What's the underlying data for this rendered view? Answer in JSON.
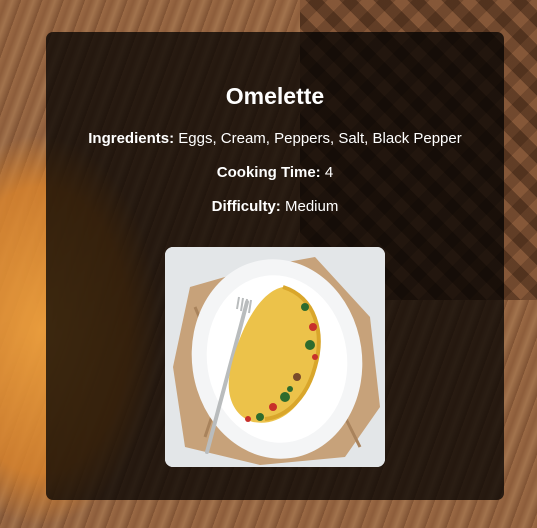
{
  "recipe": {
    "title": "Omelette",
    "ingredients_label": "Ingredients:",
    "ingredients": "Eggs, Cream, Peppers, Salt, Black Pepper",
    "cooking_time_label": "Cooking Time:",
    "cooking_time": "4",
    "difficulty_label": "Difficulty:",
    "difficulty": "Medium"
  },
  "colors": {
    "card_background": "#000000",
    "text": "#ffffff"
  }
}
